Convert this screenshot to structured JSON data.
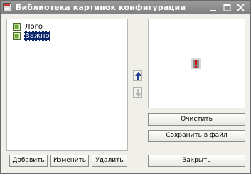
{
  "window": {
    "title": "Библиотека картинок конфигурации"
  },
  "list": {
    "items": [
      {
        "label": "Лого",
        "selected": false
      },
      {
        "label": "Важно",
        "selected": true
      }
    ]
  },
  "buttons": {
    "add": "Добавить",
    "change": "Изменить",
    "delete": "Удалить",
    "clear": "Очистить",
    "save_to_file": "Сохранить в файл",
    "close": "Закрыть"
  },
  "colors": {
    "selection": "#0a246a",
    "titlebar": "#8c8c8c",
    "move_up_arrow": "#1f3f8f"
  },
  "icons": {
    "move_up": "arrow-up-icon",
    "move_down": "arrow-down-icon",
    "preview": "warning-icon"
  }
}
